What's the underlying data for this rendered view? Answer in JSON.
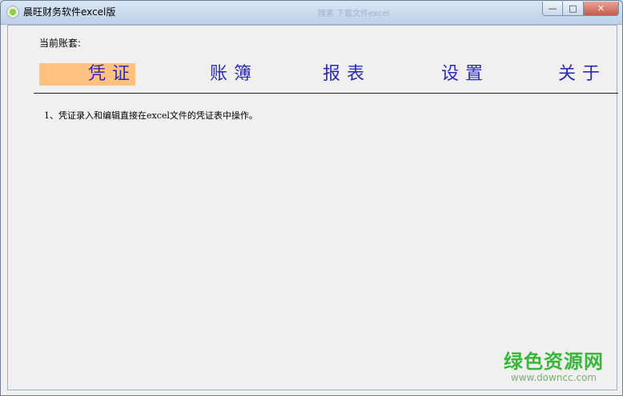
{
  "window": {
    "title": "晨旺财务软件excel版",
    "ghost_search": "搜索 下载文件excel",
    "buttons": {
      "minimize": "—",
      "maximize": "□",
      "close": "✕"
    }
  },
  "header": {
    "account_label": "当前账套:"
  },
  "menu": [
    {
      "label": "凭证",
      "active": true
    },
    {
      "label": "账簿",
      "active": false
    },
    {
      "label": "报表",
      "active": false
    },
    {
      "label": "设置",
      "active": false
    },
    {
      "label": "关于",
      "active": false
    }
  ],
  "content": {
    "note": "1、凭证录入和编辑直接在excel文件的凭证表中操作。"
  },
  "watermark": {
    "text": "绿色资源网",
    "url": "www.downcc.com"
  },
  "colors": {
    "menu_text": "#2b2bb5",
    "active_highlight": "#ffc080",
    "watermark": "#39b739"
  },
  "icons": {
    "app": "app-logo-icon"
  }
}
